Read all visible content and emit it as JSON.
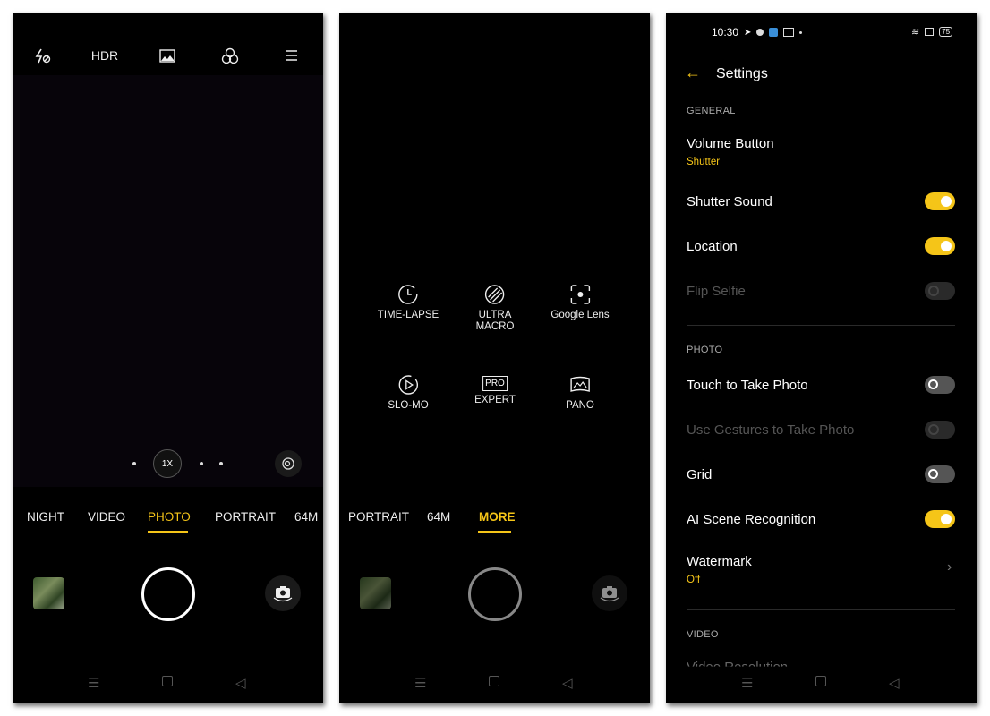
{
  "camera": {
    "top_icons": [
      "flash-off-icon",
      "HDR",
      "image-icon",
      "filter-icon",
      "menu-icon"
    ],
    "hdr_label": "HDR",
    "zoom_label": "1X",
    "modes": [
      "NIGHT",
      "VIDEO",
      "PHOTO",
      "PORTRAIT",
      "64M"
    ],
    "active_mode": "PHOTO"
  },
  "more": {
    "items": [
      {
        "label": "TIME-LAPSE",
        "icon": "timer-icon"
      },
      {
        "label": "ULTRA\nMACRO",
        "icon": "macro-icon"
      },
      {
        "label": "Google Lens",
        "icon": "google-lens-icon"
      },
      {
        "label": "SLO-MO",
        "icon": "slow-motion-icon"
      },
      {
        "label": "EXPERT",
        "icon": "pro-icon"
      },
      {
        "label": "PANO",
        "icon": "panorama-icon"
      }
    ],
    "pro_badge": "PRO",
    "modes": [
      "PORTRAIT",
      "64M",
      "MORE"
    ],
    "active_mode": "MORE"
  },
  "settings": {
    "status": {
      "time": "10:30",
      "battery": "75"
    },
    "title": "Settings",
    "sections": {
      "general": "GENERAL",
      "photo": "PHOTO",
      "video": "VIDEO"
    },
    "volume_button": {
      "label": "Volume Button",
      "value": "Shutter"
    },
    "shutter_sound": {
      "label": "Shutter Sound",
      "on": true
    },
    "location": {
      "label": "Location",
      "on": true
    },
    "flip_selfie": {
      "label": "Flip Selfie",
      "on": false,
      "disabled": true
    },
    "touch_photo": {
      "label": "Touch to Take Photo",
      "on": false
    },
    "gestures": {
      "label": "Use Gestures to Take Photo",
      "on": false,
      "disabled": true
    },
    "grid": {
      "label": "Grid",
      "on": false
    },
    "ai_scene": {
      "label": "AI Scene Recognition",
      "on": true
    },
    "watermark": {
      "label": "Watermark",
      "value": "Off"
    },
    "video_resolution": {
      "label": "Video Resolution"
    }
  },
  "colors": {
    "accent": "#f5c518",
    "background": "#000000"
  }
}
